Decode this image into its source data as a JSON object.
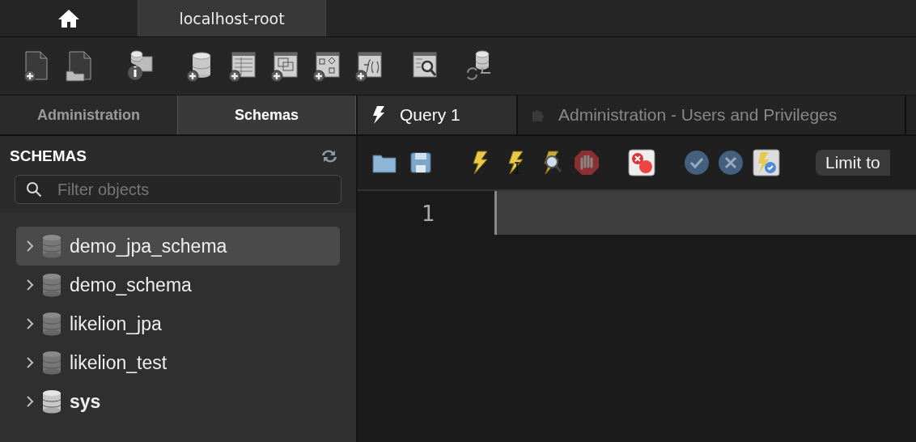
{
  "window_tabs": [
    {
      "kind": "home",
      "selected": false
    },
    {
      "kind": "connection",
      "label": "localhost-root",
      "selected": true
    }
  ],
  "sidebar": {
    "tabs": [
      {
        "label": "Administration",
        "selected": false
      },
      {
        "label": "Schemas",
        "selected": true
      }
    ],
    "title": "SCHEMAS",
    "filter": {
      "placeholder": "Filter objects"
    },
    "schemas": [
      {
        "name": "demo_jpa_schema",
        "selected": true,
        "default": false
      },
      {
        "name": "demo_schema",
        "selected": false,
        "default": false
      },
      {
        "name": "likelion_jpa",
        "selected": false,
        "default": false
      },
      {
        "name": "likelion_test",
        "selected": false,
        "default": false
      },
      {
        "name": "sys",
        "selected": false,
        "default": true
      }
    ]
  },
  "editor": {
    "tabs": [
      {
        "label": "Query 1",
        "kind": "query",
        "selected": true
      },
      {
        "label": "Administration - Users and Privileges",
        "kind": "admin",
        "selected": false
      }
    ],
    "limit_button": "Limit to",
    "lines": [
      {
        "number": "1",
        "current": true
      }
    ]
  }
}
